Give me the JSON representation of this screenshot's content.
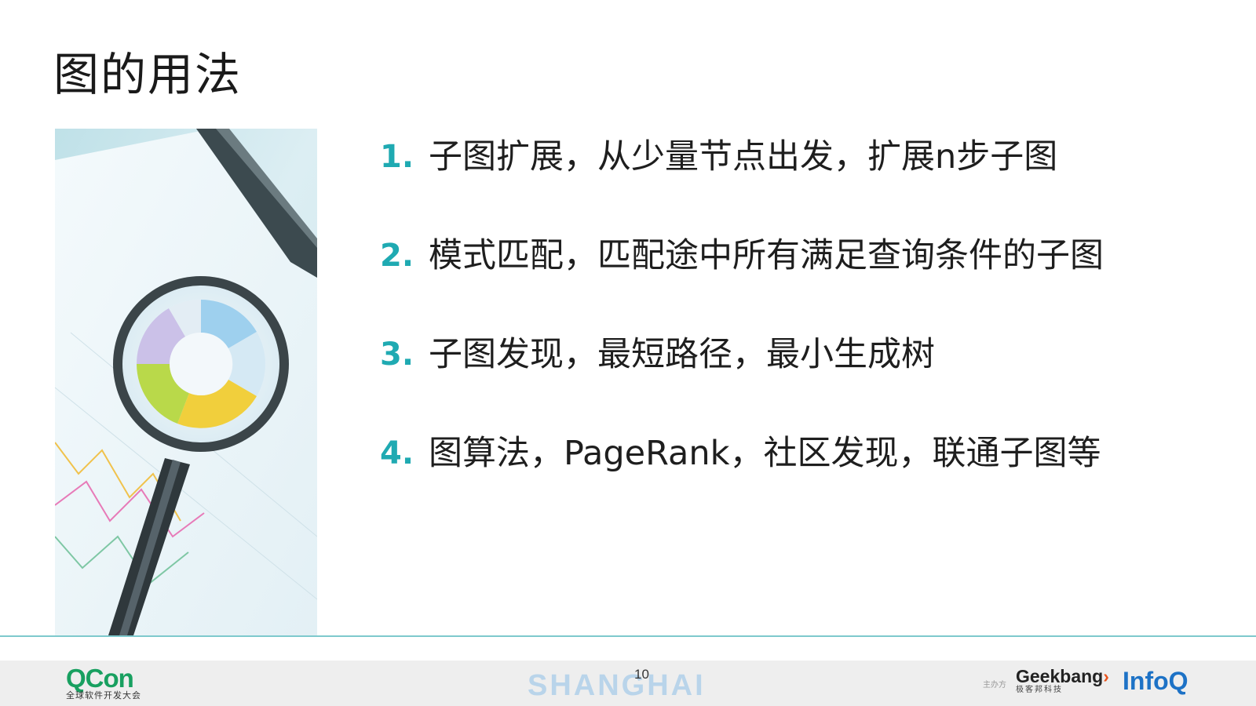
{
  "slide": {
    "title": "图的用法",
    "items": [
      {
        "num": "1.",
        "text": "子图扩展，从少量节点出发，扩展n步子图"
      },
      {
        "num": "2.",
        "text": "模式匹配，匹配途中所有满足查询条件的子图"
      },
      {
        "num": "3.",
        "text": "子图发现，最短路径，最小生成树"
      },
      {
        "num": "4.",
        "text": "图算法，PageRank，社区发现，联通子图等"
      }
    ],
    "page_number": "10"
  },
  "footer": {
    "qcon_logo": "QCon",
    "qcon_tagline": "全球软件开发大会",
    "city": "SHANGHAI",
    "host_label": "主办方",
    "geekbang_logo": "Geekbang",
    "geekbang_sub": "极客邦科技",
    "infoq_logo": "InfoQ"
  },
  "colors": {
    "accent": "#1faab2",
    "divider": "#7ec9cd",
    "footer_bg": "#eeeeee"
  },
  "icons": {
    "photo": "magnifier-chart-image"
  }
}
